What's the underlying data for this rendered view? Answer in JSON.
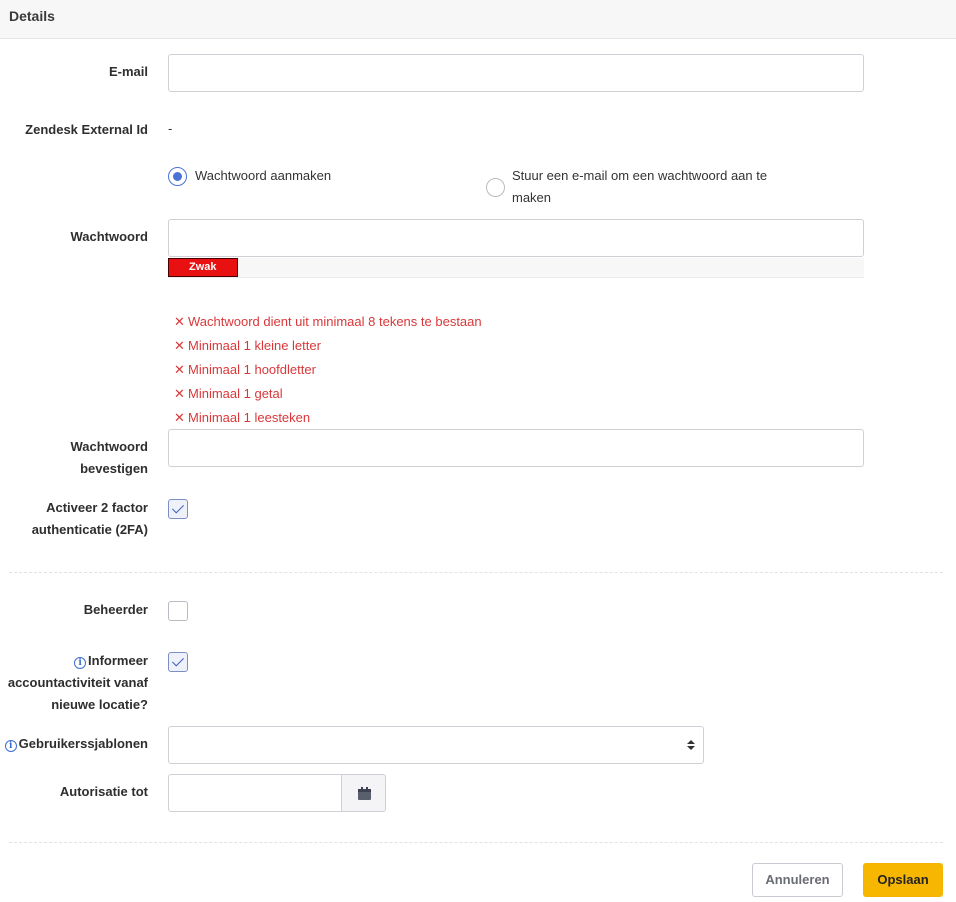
{
  "header": {
    "title": "Details"
  },
  "fields": {
    "email": {
      "label": "E-mail",
      "value": ""
    },
    "zendesk": {
      "label": "Zendesk External Id",
      "value": "-"
    },
    "password_mode": {
      "option_create": "Wachtwoord aanmaken",
      "option_email_line1": "Stuur een e-mail om een wachtwoord aan te",
      "option_email_line2": "maken",
      "selected": "create"
    },
    "password": {
      "label": "Wachtwoord",
      "value": ""
    },
    "strength": {
      "label": "Zwak",
      "level": 0.1,
      "color": "#e81010"
    },
    "rules": [
      "Wachtwoord dient uit minimaal 8 tekens te bestaan",
      "Minimaal 1 kleine letter",
      "Minimaal 1 hoofdletter",
      "Minimaal 1 getal",
      "Minimaal 1 leesteken"
    ],
    "confirm": {
      "label_line1": "Wachtwoord",
      "label_line2": "bevestigen",
      "value": ""
    },
    "twofa": {
      "label_line1": "Activeer 2 factor",
      "label_line2": "authenticatie (2FA)",
      "checked": true
    },
    "admin": {
      "label": "Beheerder",
      "checked": false
    },
    "inform": {
      "label_line1": "Informeer",
      "label_line2": "accountactiviteit vanaf",
      "label_line3": "nieuwe locatie?",
      "checked": true
    },
    "templates": {
      "label": "Gebruikerssjablonen",
      "value": ""
    },
    "authorization": {
      "label": "Autorisatie tot",
      "value": ""
    }
  },
  "footer": {
    "cancel_label": "Annuleren",
    "save_label": "Opslaan"
  },
  "colors": {
    "accent": "#4a73d6",
    "error": "#d9383a",
    "primary_button": "#f7b700"
  }
}
